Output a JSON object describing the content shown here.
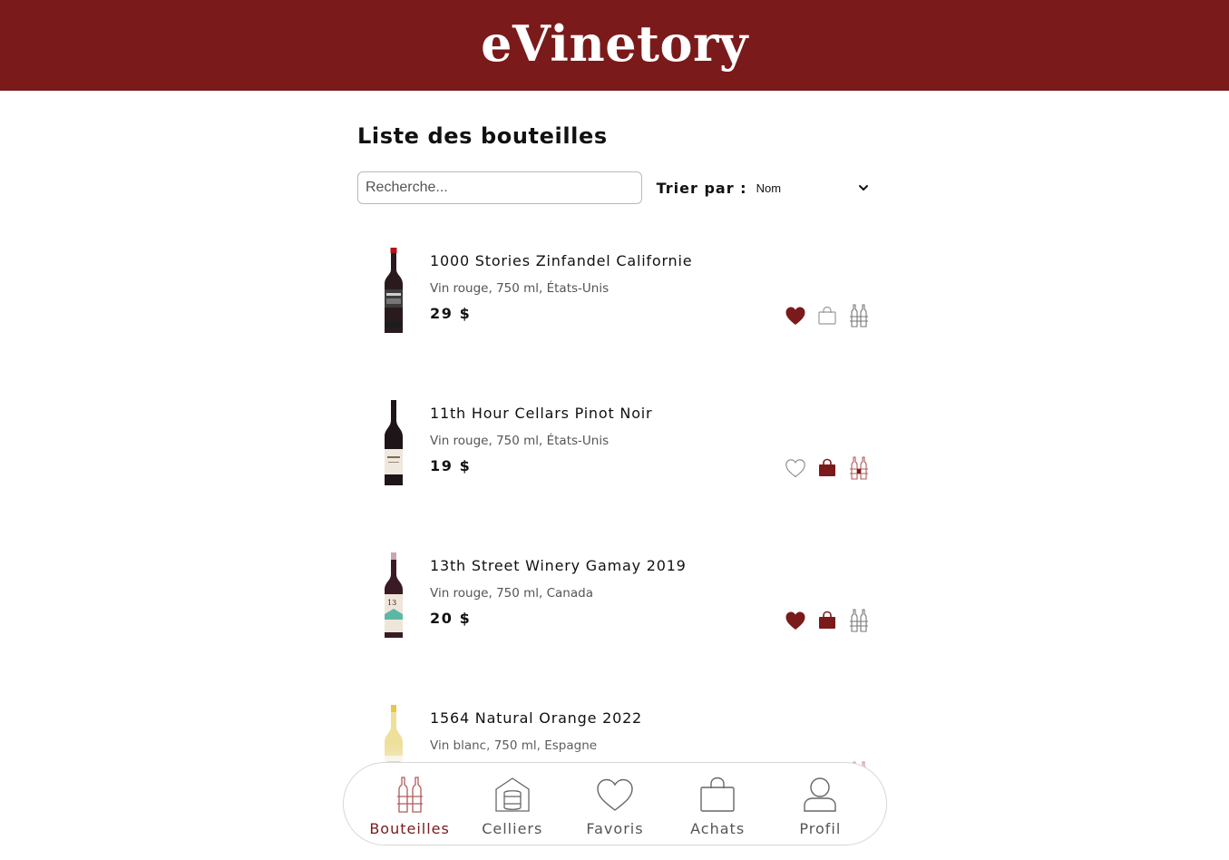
{
  "app": {
    "logo": "eVinetory",
    "accent_color": "#7b1a1a"
  },
  "page": {
    "title": "Liste des bouteilles"
  },
  "search": {
    "placeholder": "Recherche...",
    "value": ""
  },
  "sort": {
    "label": "Trier par :",
    "selected": "Nom"
  },
  "bottles": [
    {
      "name": "1000 Stories Zinfandel Californie",
      "meta": "Vin rouge, 750 ml, États-Unis",
      "price": "29 $",
      "image_icon": "red-wine-bottle-icon",
      "favorite": true,
      "purchased": false,
      "in_cellar": false
    },
    {
      "name": "11th Hour Cellars Pinot Noir",
      "meta": "Vin rouge, 750 ml, États-Unis",
      "price": "19 $",
      "image_icon": "red-wine-bottle-icon",
      "favorite": false,
      "purchased": true,
      "in_cellar": true
    },
    {
      "name": "13th Street Winery Gamay 2019",
      "meta": "Vin rouge, 750 ml, Canada",
      "price": "20 $",
      "image_icon": "red-wine-bottle-icon",
      "favorite": true,
      "purchased": true,
      "in_cellar": false
    },
    {
      "name": "1564 Natural Orange 2022",
      "meta": "Vin blanc, 750 ml, Espagne",
      "price": "",
      "image_icon": "white-wine-bottle-icon",
      "favorite": false,
      "purchased": false,
      "in_cellar": true
    }
  ],
  "nav": {
    "items": [
      {
        "label": "Bouteilles",
        "icon": "bottles-icon",
        "active": true
      },
      {
        "label": "Celliers",
        "icon": "cellar-icon",
        "active": false
      },
      {
        "label": "Favoris",
        "icon": "heart-icon",
        "active": false
      },
      {
        "label": "Achats",
        "icon": "shopping-bag-icon",
        "active": false
      },
      {
        "label": "Profil",
        "icon": "user-icon",
        "active": false
      }
    ]
  }
}
